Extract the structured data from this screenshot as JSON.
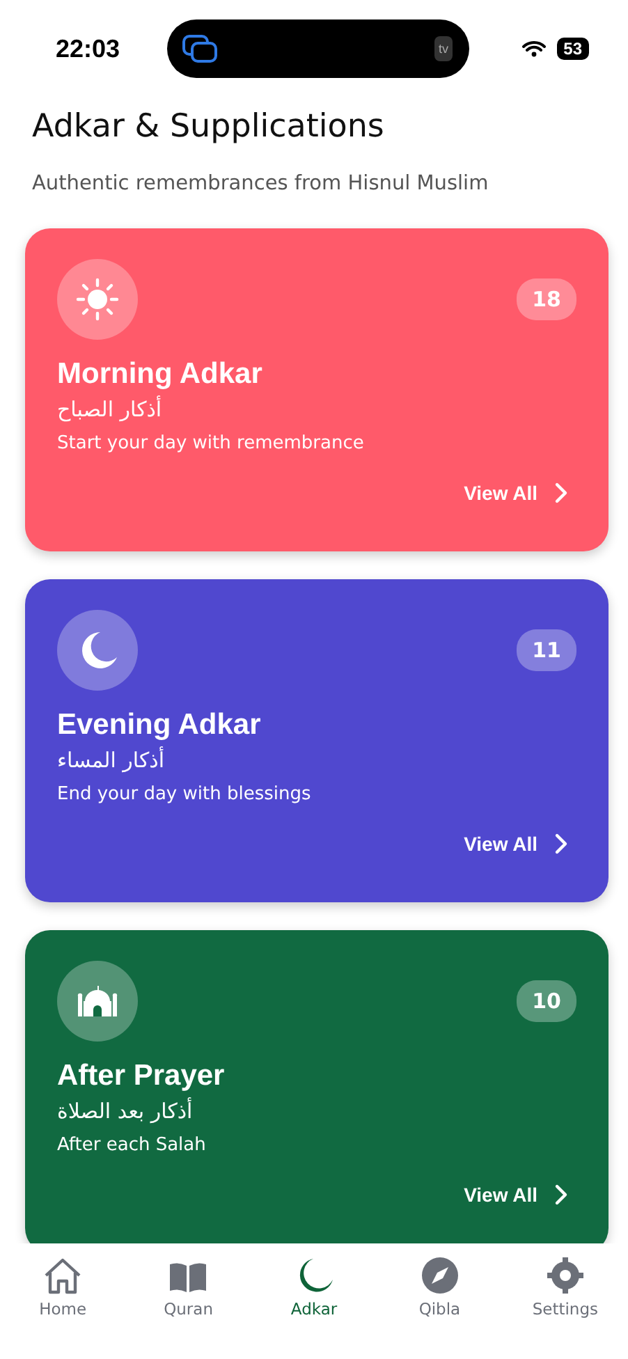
{
  "status_bar": {
    "time": "22:03",
    "island_badge": "tv",
    "battery": "53"
  },
  "header": {
    "title": "Adkar & Supplications",
    "subtitle": "Authentic remembrances from Hisnul Muslim"
  },
  "cards": [
    {
      "kind": "sun",
      "color": "#ff5a6a",
      "title": "Morning Adkar",
      "arabic": "أذكار الصباح",
      "description": "Start your day with remembrance",
      "count": "18",
      "action": "View All"
    },
    {
      "kind": "moon",
      "color": "#5048cf",
      "title": "Evening Adkar",
      "arabic": "أذكار المساء",
      "description": "End your day with blessings",
      "count": "11",
      "action": "View All"
    },
    {
      "kind": "mosque",
      "color": "#116a41",
      "title": "After Prayer",
      "arabic": "أذكار بعد الصلاة",
      "description": "After each Salah",
      "count": "10",
      "action": "View All"
    }
  ],
  "tab_bar": [
    {
      "kind": "home",
      "label": "Home",
      "selected": false
    },
    {
      "kind": "book",
      "label": "Quran",
      "selected": false
    },
    {
      "kind": "moon",
      "label": "Adkar",
      "selected": true
    },
    {
      "kind": "compass",
      "label": "Qibla",
      "selected": false
    },
    {
      "kind": "gear",
      "label": "Settings",
      "selected": false
    }
  ]
}
